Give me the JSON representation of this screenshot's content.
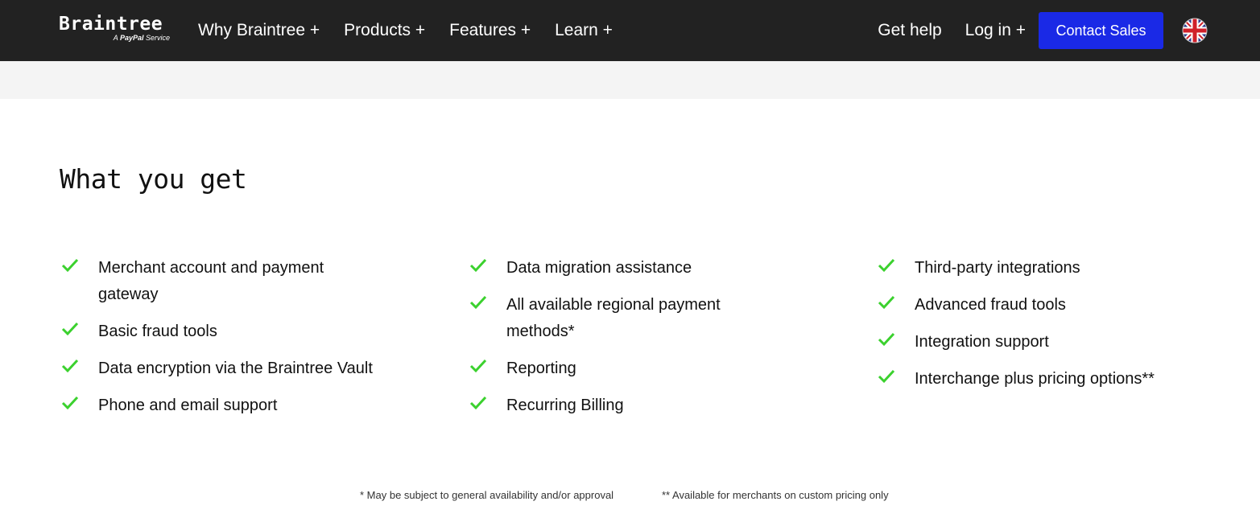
{
  "header": {
    "logo_text": "Braintree",
    "logo_sub_a": "A",
    "logo_sub_brand": "PayPal",
    "logo_sub_service": "Service",
    "nav": [
      {
        "label": "Why Braintree +"
      },
      {
        "label": "Products +"
      },
      {
        "label": "Features +"
      },
      {
        "label": "Learn +"
      }
    ],
    "get_help": "Get help",
    "login": "Log in +",
    "contact_sales": "Contact Sales",
    "language_icon": "uk-flag-icon"
  },
  "main": {
    "heading": "What you get",
    "columns": [
      [
        "Merchant account and payment gateway",
        "Basic fraud tools",
        "Data encryption via the Braintree Vault",
        "Phone and email support"
      ],
      [
        "Data migration assistance",
        "All available regional payment methods*",
        "Reporting",
        "Recurring Billing"
      ],
      [
        "Third-party integrations",
        "Advanced fraud tools",
        "Integration support",
        "Interchange plus pricing options**"
      ]
    ],
    "check_icon": "check-icon",
    "check_color": "#3bd12e"
  },
  "footnotes": {
    "note1": "* May be subject to general availability and/or approval",
    "note2": "** Available for merchants on custom pricing only"
  },
  "colors": {
    "topbar": "#222222",
    "accent": "#1a29e6",
    "band": "#f4f4f4"
  }
}
